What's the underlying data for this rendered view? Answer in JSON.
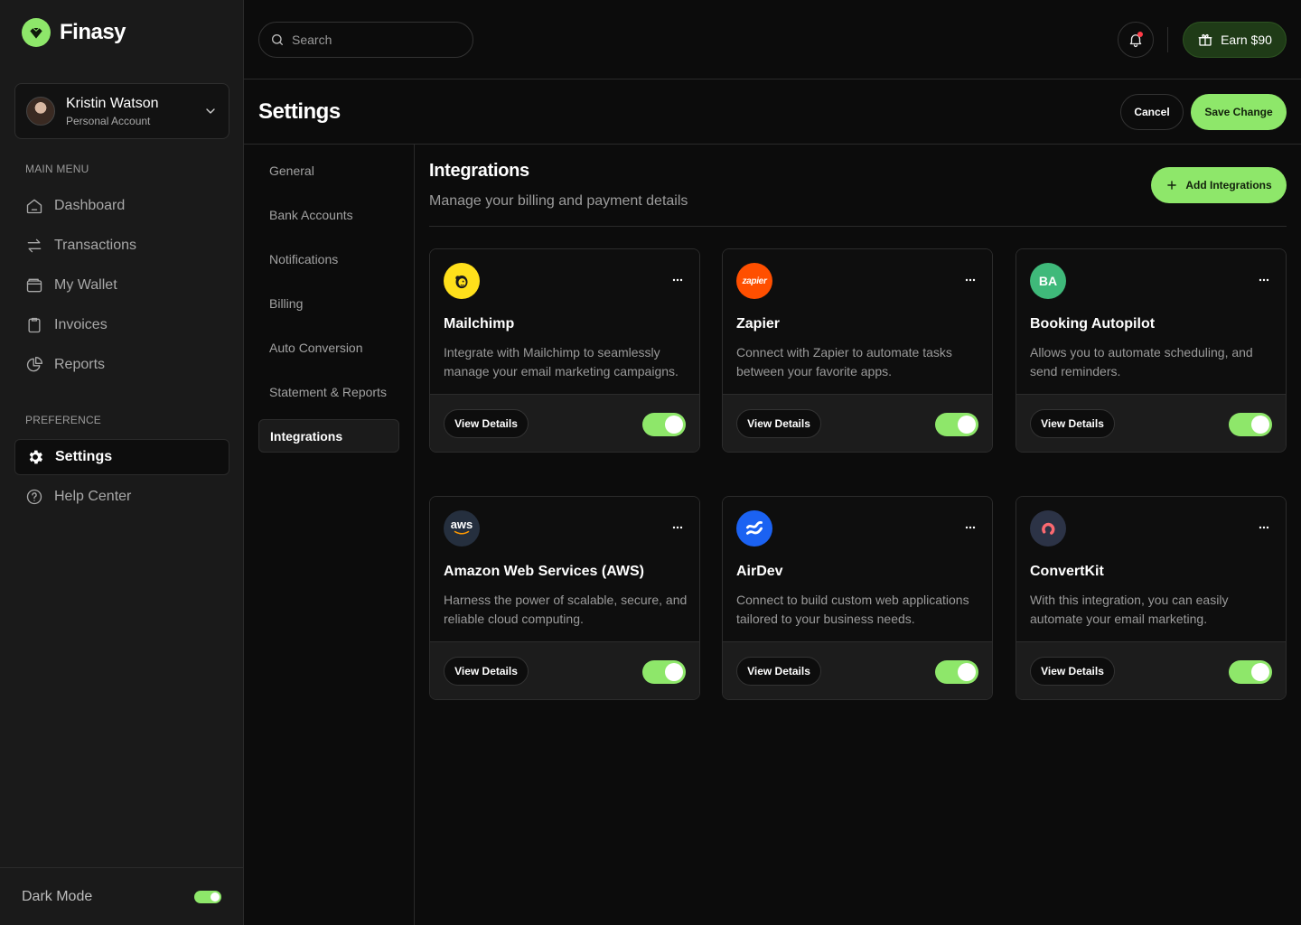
{
  "brand": {
    "name": "Finasy",
    "accent": "#8ee76a"
  },
  "account": {
    "name": "Kristin Watson",
    "type": "Personal Account"
  },
  "sidebar": {
    "main_menu_label": "MAIN MENU",
    "main_items": [
      {
        "label": "Dashboard",
        "icon": "home-icon"
      },
      {
        "label": "Transactions",
        "icon": "arrows-swap-icon"
      },
      {
        "label": "My Wallet",
        "icon": "wallet-icon"
      },
      {
        "label": "Invoices",
        "icon": "clipboard-icon"
      },
      {
        "label": "Reports",
        "icon": "pie-chart-icon"
      }
    ],
    "preference_label": "PREFERENCE",
    "pref_items": [
      {
        "label": "Settings",
        "icon": "gear-icon",
        "active": true
      },
      {
        "label": "Help Center",
        "icon": "help-circle-icon"
      }
    ],
    "dark_mode_label": "Dark Mode"
  },
  "topbar": {
    "search_placeholder": "Search",
    "earn_label": "Earn $90"
  },
  "header": {
    "title": "Settings",
    "cancel_label": "Cancel",
    "save_label": "Save Change"
  },
  "subnav": {
    "items": [
      "General",
      "Bank Accounts",
      "Notifications",
      "Billing",
      "Auto Conversion",
      "Statement & Reports",
      "Integrations"
    ],
    "active": "Integrations"
  },
  "integrations": {
    "title": "Integrations",
    "subtitle": "Manage your billing and payment details",
    "add_label": "Add Integrations",
    "view_label": "View Details",
    "cards": [
      {
        "name": "Mailchimp",
        "description": "Integrate with Mailchimp to seamlessly manage your email marketing campaigns.",
        "icon": "mailchimp-logo",
        "enabled": true
      },
      {
        "name": "Zapier",
        "description": "Connect with Zapier to automate tasks between your favorite apps.",
        "icon": "zapier-logo",
        "logo_text": "zapier",
        "enabled": true
      },
      {
        "name": "Booking Autopilot",
        "description": "Allows you to automate scheduling, and send reminders.",
        "icon": "booking-autopilot-logo",
        "logo_text": "BA",
        "enabled": true
      },
      {
        "name": "Amazon Web Services (AWS)",
        "description": "Harness the power of scalable, secure, and reliable cloud computing.",
        "icon": "aws-logo",
        "logo_text": "aws",
        "enabled": true
      },
      {
        "name": "AirDev",
        "description": "Connect to build custom web applications tailored to your business needs.",
        "icon": "airdev-logo",
        "enabled": true
      },
      {
        "name": "ConvertKit",
        "description": "With this integration, you can easily automate your email marketing.",
        "icon": "convertkit-logo",
        "enabled": true
      }
    ]
  }
}
